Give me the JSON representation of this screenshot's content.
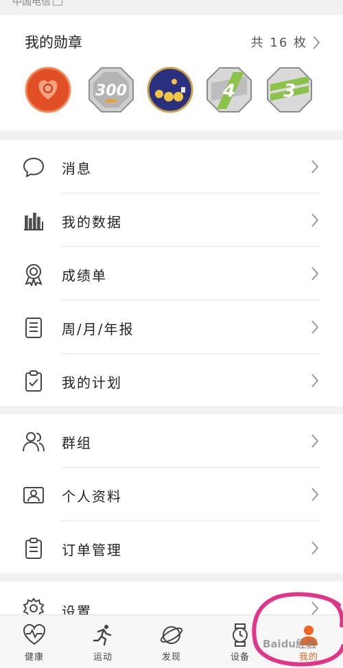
{
  "status": {
    "carrier": "中国电信"
  },
  "badges": {
    "title": "我的勋章",
    "count_text": "共 16 枚",
    "items": [
      {
        "icon": "heart-medal-icon",
        "color": "#e8552a"
      },
      {
        "icon": "300-medal-icon",
        "color": "#b8b8b8",
        "label": "300"
      },
      {
        "icon": "night-medal-icon",
        "color": "#2b2f7a"
      },
      {
        "icon": "4-medal-icon",
        "color": "#c9c9c9",
        "label": "4"
      },
      {
        "icon": "3-medal-icon",
        "color": "#8bc34a",
        "label": "3"
      }
    ]
  },
  "menu1": [
    {
      "label": "消息",
      "icon": "message-icon"
    },
    {
      "label": "我的数据",
      "icon": "chart-icon"
    },
    {
      "label": "成绩单",
      "icon": "award-icon"
    },
    {
      "label": "周/月/年报",
      "icon": "report-icon"
    },
    {
      "label": "我的计划",
      "icon": "plan-icon"
    }
  ],
  "menu2": [
    {
      "label": "群组",
      "icon": "group-icon"
    },
    {
      "label": "个人资料",
      "icon": "profile-icon"
    },
    {
      "label": "订单管理",
      "icon": "order-icon"
    }
  ],
  "menu3": [
    {
      "label": "设置",
      "icon": "settings-icon"
    }
  ],
  "tabs": [
    {
      "label": "健康",
      "icon": "health-icon",
      "active": false
    },
    {
      "label": "运动",
      "icon": "run-icon",
      "active": false
    },
    {
      "label": "发现",
      "icon": "discover-icon",
      "active": false
    },
    {
      "label": "设备",
      "icon": "watch-icon",
      "active": false
    },
    {
      "label": "我的",
      "icon": "me-icon",
      "active": true
    }
  ],
  "watermark": "Baidu经验",
  "colors": {
    "accent": "#f0651f",
    "annotation": "#e0368a"
  }
}
